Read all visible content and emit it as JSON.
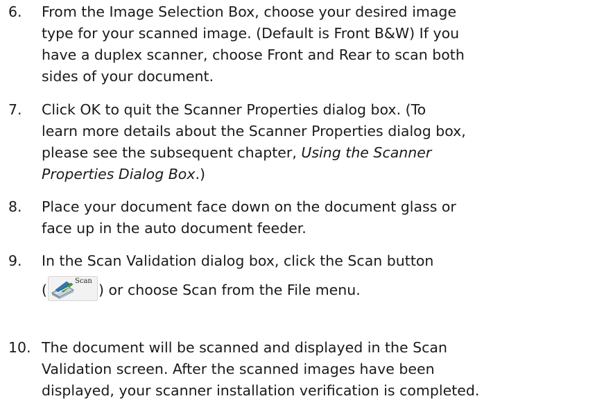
{
  "steps": [
    {
      "number": "6.",
      "lines": [
        "From the Image Selection Box, choose your desired image",
        "type for your scanned image.  (Default is Front B&W)  If you",
        "have a duplex scanner, choose Front and Rear to scan both",
        "sides of your document."
      ]
    },
    {
      "number": "7.",
      "line1": "Click OK to quit the Scanner Properties dialog box.  (To",
      "line2": "learn more details about the Scanner Properties dialog box,",
      "line3_plain": "please see the subsequent chapter, ",
      "line3_italic": "Using the Scanner",
      "line4_italic": "Properties Dialog Box",
      "line4_tail": ".)"
    },
    {
      "number": "8.",
      "lines": [
        "Place your document face down on the document glass or",
        "face up in the auto document feeder."
      ]
    },
    {
      "number": "9.",
      "line1": "In the Scan Validation dialog box, click the Scan button",
      "open_paren": "(",
      "scan_button_label": "Scan",
      "line2_tail": ") or choose Scan from the File menu."
    },
    {
      "number": "10.",
      "lines": [
        "The document will be scanned and displayed in the Scan",
        "Validation screen.  After the scanned images have been",
        "displayed, your scanner installation verification is completed."
      ]
    }
  ],
  "icons": {
    "scan_button": "scanner-icon"
  },
  "colors": {
    "text": "#1a1a1a",
    "button_face": "#f2f2f2"
  }
}
